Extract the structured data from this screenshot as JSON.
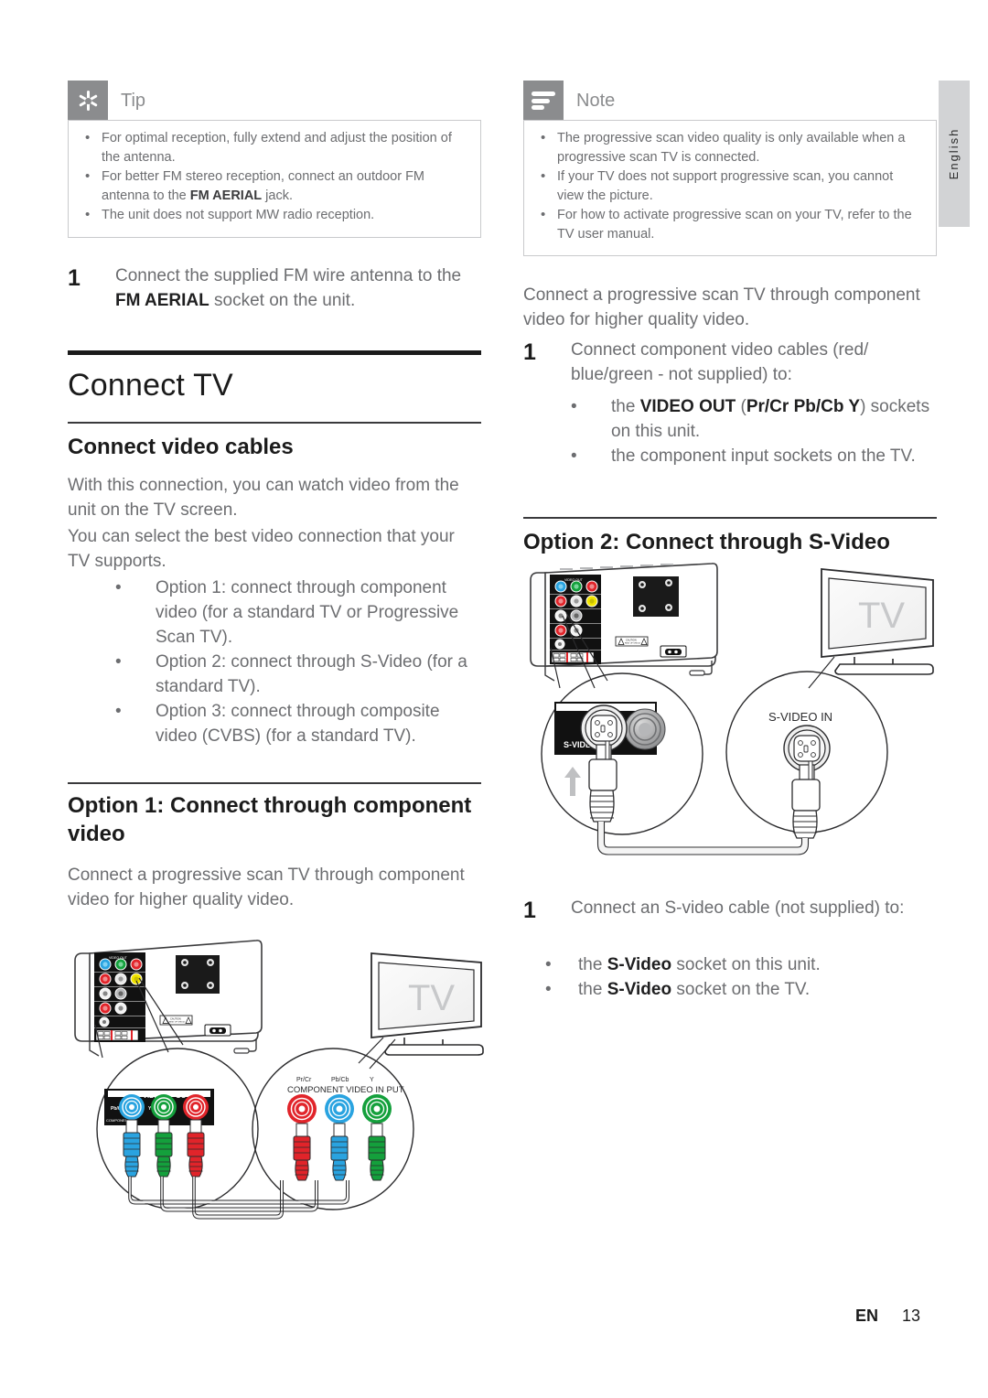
{
  "page": {
    "language_tab": "English",
    "footer_locale": "EN",
    "footer_page": "13"
  },
  "tip": {
    "icon": "asterisk-icon",
    "title": "Tip",
    "items": [
      {
        "text_before": "For optimal reception, fully extend and adjust the position of the antenna.",
        "bold": "",
        "text_after": ""
      },
      {
        "text_before": "For better FM stereo reception, connect an outdoor FM antenna to the ",
        "bold": "FM AERIAL",
        "text_after": " jack."
      },
      {
        "text_before": "The unit does not support MW radio reception.",
        "bold": "",
        "text_after": ""
      }
    ]
  },
  "note": {
    "icon": "lines-icon",
    "title": "Note",
    "items": [
      {
        "text_before": "The progressive scan video quality is only available when a progressive scan TV is connected.",
        "bold": "",
        "text_after": ""
      },
      {
        "text_before": "If your TV does not support progressive scan, you cannot view the picture.",
        "bold": "",
        "text_after": ""
      },
      {
        "text_before": "For how to activate progressive scan on your TV, refer to the TV user manual.",
        "bold": "",
        "text_after": ""
      }
    ]
  },
  "left_column": {
    "antenna_step": {
      "number": "1",
      "text_before": "Connect the supplied FM wire antenna to the ",
      "bold": "FM AERIAL",
      "text_after": " socket on the unit."
    },
    "heading_main": "Connect TV",
    "heading_sub": "Connect video cables",
    "intro_1": "With this connection, you can watch video from the unit on the TV screen.",
    "intro_2": "You can select the best video connection that your TV supports.",
    "options": [
      "Option 1: connect through component video (for a standard TV or Progressive Scan TV).",
      "Option 2: connect through S-Video (for a standard TV).",
      "Option 3: connect through composite video (CVBS) (for a standard TV)."
    ],
    "option1_heading": "Option 1: Connect through component video",
    "option1_intro": "Connect a progressive scan TV through component video for higher quality video."
  },
  "right_column": {
    "intro": "Connect a progressive scan TV through component video for higher quality video.",
    "step": {
      "number": "1",
      "text": "Connect component video cables (red/ blue/green - not supplied) to:"
    },
    "step_bullets": [
      {
        "pre": "the ",
        "bold": "VIDEO OUT",
        "mid": " (",
        "bold2": "Pr/Cr Pb/Cb Y",
        "post": ") sockets on this unit."
      },
      {
        "pre": "the component input sockets on the TV.",
        "bold": "",
        "mid": "",
        "bold2": "",
        "post": ""
      }
    ],
    "option2_heading": "Option 2: Connect through S-Video",
    "svideo_step": {
      "number": "1",
      "text": "Connect an S-video cable (not supplied) to:"
    },
    "svideo_bullets": [
      {
        "pre": "the ",
        "bold": "S-Video",
        "post": " socket on this unit."
      },
      {
        "pre": "the ",
        "bold": "S-Video",
        "post": " socket on the TV."
      }
    ]
  },
  "figure_component": {
    "name": "component-video-connection-diagram",
    "tv_label": "TV",
    "unit_panel_labels": [
      "VIDEO",
      "OUT",
      "CAUTION"
    ],
    "detail_unit": {
      "title_left": "VIDEO",
      "title_right": "OUT",
      "jack_left_label": "Pb/Cb",
      "jack_mid_label": "Y",
      "jack_right_label": "Pr/Cr",
      "small_label": "COMPONENT",
      "jack_colors": [
        "#29a3e0",
        "#14a03c",
        "#e1242a"
      ]
    },
    "detail_tv": {
      "labels": [
        "Pr/Cr",
        "Pb/Cb",
        "Y"
      ],
      "caption": "COMPONENT VIDEO IN PUT",
      "jack_colors": [
        "#e1242a",
        "#29a3e0",
        "#14a03c"
      ]
    }
  },
  "figure_svideo": {
    "name": "s-video-connection-diagram",
    "tv_label": "TV",
    "detail_unit_label": "S-VIDEO",
    "detail_tv_label": "S-VIDEO IN"
  },
  "colors": {
    "callout_grey": "#8b8c8e",
    "border_grey": "#c9cacc",
    "body_text": "#6c6d70",
    "heading_text": "#1b1b1b",
    "lang_tab_bg": "#d2d3d5",
    "red": "#e1242a",
    "green": "#14a03c",
    "blue": "#29a3e0",
    "yellow": "#f2e500"
  }
}
